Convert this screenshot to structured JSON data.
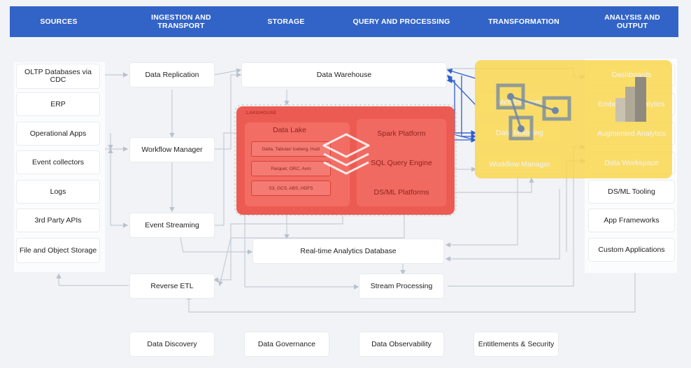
{
  "header": {
    "sources": "SOURCES",
    "ingestion": "INGESTION AND TRANSPORT",
    "storage": "STORAGE",
    "query": "QUERY AND PROCESSING",
    "transformation": "TRANSFORMATION",
    "analysis": "ANALYSIS AND OUTPUT"
  },
  "sources": [
    "OLTP Databases via CDC",
    "ERP",
    "Operational Apps",
    "Event collectors",
    "Logs",
    "3rd Party APIs",
    "File and Object Storage"
  ],
  "ingestion": {
    "replication": "Data Replication",
    "workflow": "Workflow Manager",
    "streaming": "Event Streaming",
    "reverse_etl": "Reverse ETL"
  },
  "storage": {
    "warehouse": "Data Warehouse",
    "lakehouse_label": "LAKEHOUSE",
    "data_lake": "Data Lake",
    "formats": "Delta, Tabular/ Iceberg, Hudi",
    "files": "Parquet, ORC, Avro",
    "object_stores": "S3, GCS, ABS, HDFS",
    "realtime_db": "Real-time Analytics Database"
  },
  "query": {
    "spark": "Spark Platform",
    "sql": "SQL Query Engine",
    "dsml": "DS/ML Platforms",
    "stream": "Stream Processing"
  },
  "transformation": {
    "metrics": "Metrics Layer",
    "modeling": "Data Modeling",
    "workflow": "Workflow Manager"
  },
  "analysis": [
    "Dashboards",
    "Embedded Analytics",
    "Augmented Analytics",
    "Data Workspace",
    "DS/ML Tooling",
    "App Frameworks",
    "Custom Applications"
  ],
  "footer": {
    "discovery": "Data Discovery",
    "governance": "Data Governance",
    "observability": "Data Observability",
    "entitlements": "Entitlements & Security"
  },
  "colors": {
    "header": "#3264c8",
    "lakehouse_overlay": "#ec5b52",
    "transformation_overlay": "#f9d648",
    "arrow_blue": "#2f5fc9",
    "connector": "#c5ccd6"
  }
}
